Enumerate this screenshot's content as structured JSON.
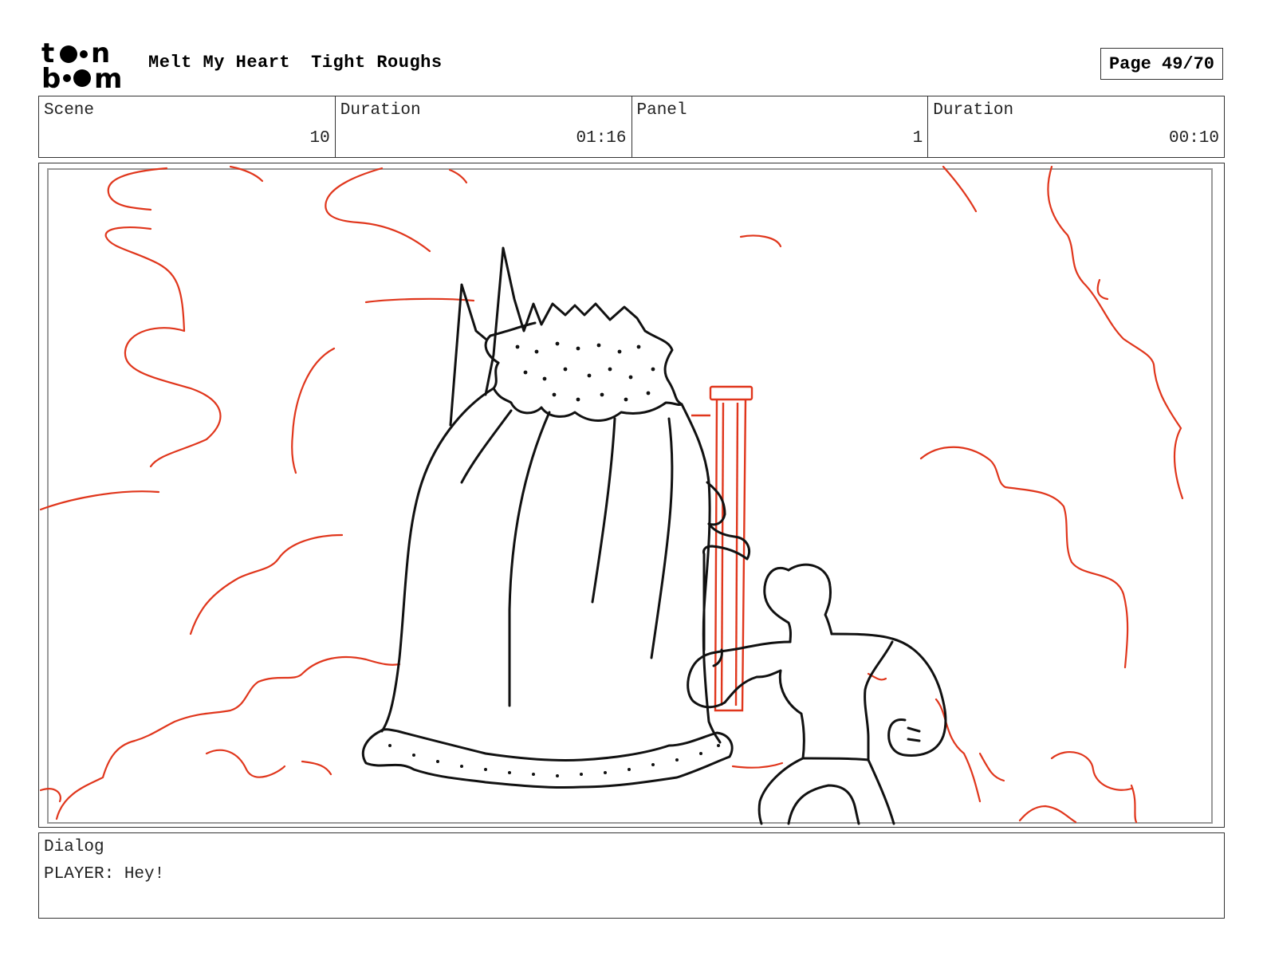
{
  "header": {
    "logo_text": "toonboom",
    "project": "Melt My Heart",
    "stage": "Tight Roughs",
    "page": "Page 49/70"
  },
  "info": [
    {
      "label": "Scene",
      "value": "10"
    },
    {
      "label": "Duration",
      "value": "01:16"
    },
    {
      "label": "Panel",
      "value": "1"
    },
    {
      "label": "Duration",
      "value": "00:10"
    }
  ],
  "panel": {
    "colors": {
      "linework": "#111111",
      "effects": "#e0361c",
      "frame": "#9a9a9a"
    }
  },
  "dialog": {
    "label": "Dialog",
    "text": "PLAYER: Hey!"
  }
}
